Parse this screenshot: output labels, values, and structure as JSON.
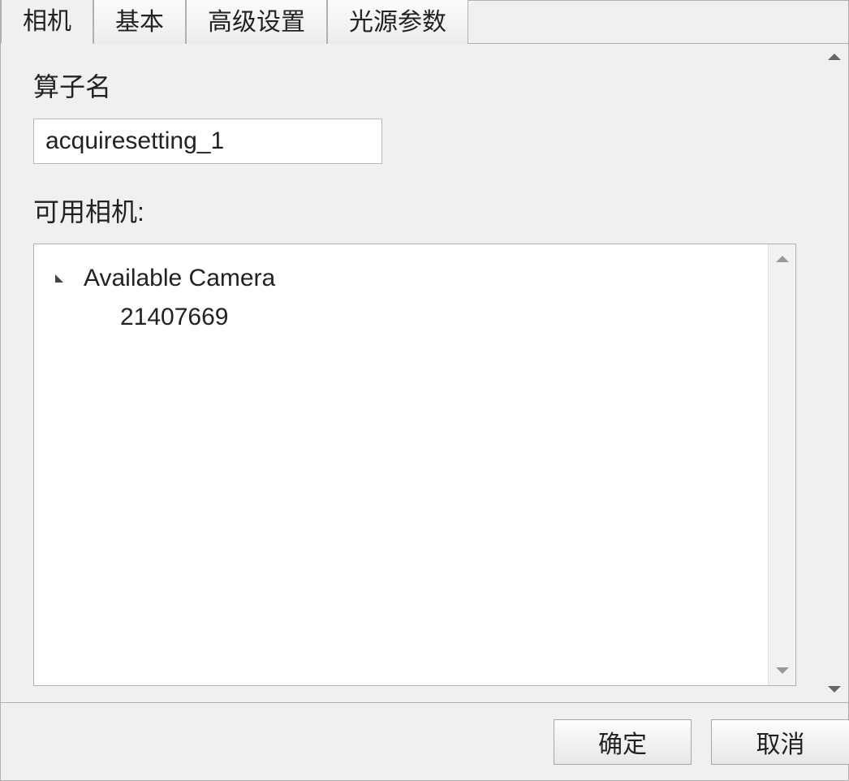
{
  "tabs": {
    "items": [
      {
        "label": "相机",
        "active": true
      },
      {
        "label": "基本",
        "active": false
      },
      {
        "label": "高级设置",
        "active": false
      },
      {
        "label": "光源参数",
        "active": false
      }
    ]
  },
  "content": {
    "operator_name_label": "算子名",
    "operator_name_value": "acquiresetting_1",
    "available_cameras_label": "可用相机:"
  },
  "tree": {
    "root_label": "Available Camera",
    "children": [
      {
        "label": "21407669"
      }
    ]
  },
  "footer": {
    "ok_label": "确定",
    "cancel_label": "取消"
  }
}
